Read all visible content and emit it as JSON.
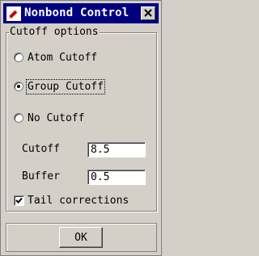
{
  "window": {
    "title": "Nonbond Control",
    "close_icon": "close-icon",
    "app_icon": "app-pencil-icon"
  },
  "cutoff_options": {
    "legend": "Cutoff options",
    "selected": "Group Cutoff",
    "options": [
      {
        "label": "Atom Cutoff",
        "checked": false
      },
      {
        "label": "Group Cutoff",
        "checked": true
      },
      {
        "label": "No Cutoff",
        "checked": false
      }
    ]
  },
  "fields": {
    "cutoff_label": "Cutoff",
    "cutoff_value": "8.5",
    "buffer_label": "Buffer",
    "buffer_value": "0.5"
  },
  "tail_corrections": {
    "label": "Tail corrections",
    "checked": true
  },
  "footer": {
    "ok_label": "OK"
  },
  "colors": {
    "titlebar": "#000080",
    "face": "#d4d0c8"
  }
}
